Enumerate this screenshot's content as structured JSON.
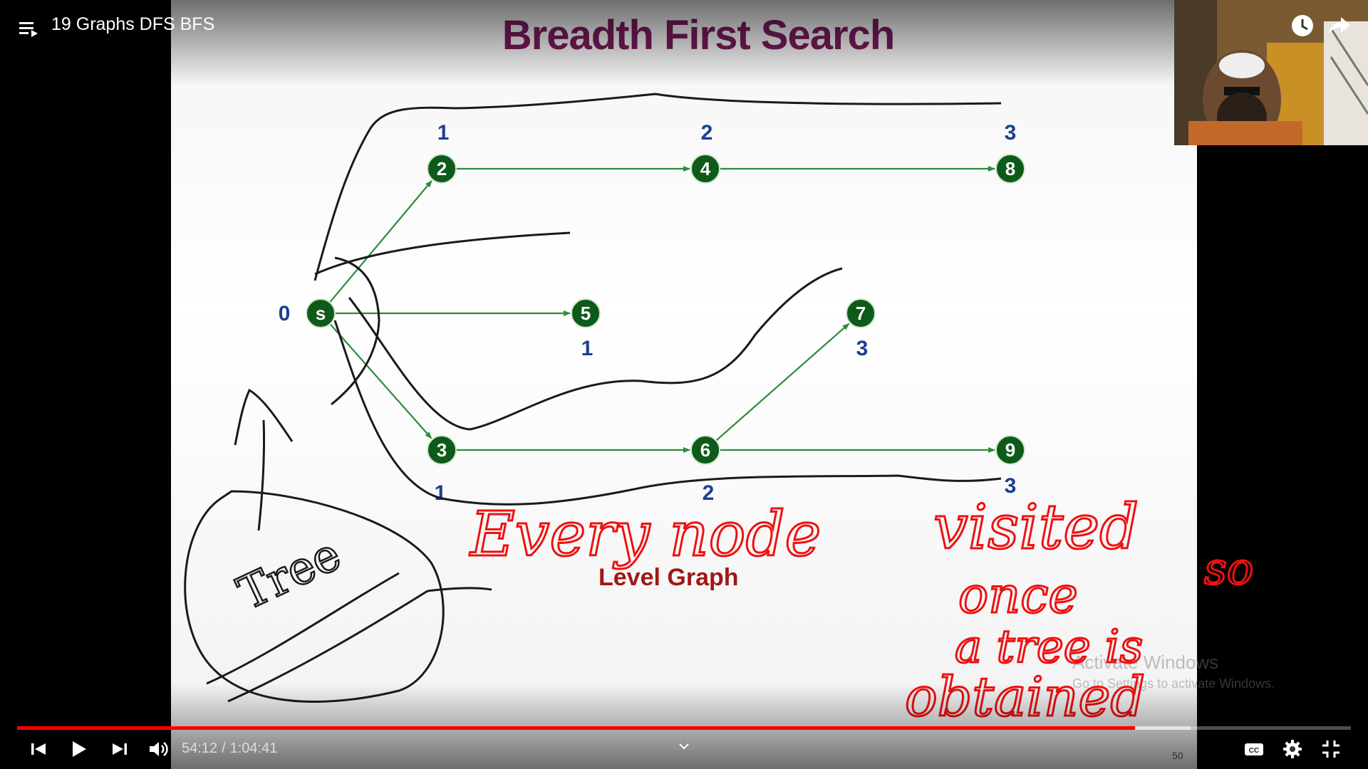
{
  "player": {
    "video_title": "19 Graphs DFS BFS",
    "time_current": "54:12",
    "time_separator": "/",
    "time_total": "1:04:41",
    "progress_played": 0.838,
    "progress_buffered": 0.88,
    "accent_color": "#ff0000",
    "icons": [
      "playlist-icon",
      "watch-later-icon",
      "share-icon",
      "previous-icon",
      "play-icon",
      "next-icon",
      "volume-icon",
      "chevron-down-icon",
      "captions-icon",
      "settings-icon",
      "exit-fullscreen-icon"
    ]
  },
  "slide": {
    "title": "Breadth First Search",
    "footer": "Level Graph",
    "page_number": "50",
    "title_color": "#7b1a5e",
    "footer_color": "#a01818",
    "node_color": "#0e5a1a",
    "edge_color": "#2e8b3a",
    "level_color": "#1c3f94",
    "nodes": [
      {
        "id": "s",
        "level": "0"
      },
      {
        "id": "2",
        "level": "1"
      },
      {
        "id": "4",
        "level": "2"
      },
      {
        "id": "8",
        "level": "3"
      },
      {
        "id": "5",
        "level": "1"
      },
      {
        "id": "7",
        "level": "3"
      },
      {
        "id": "3",
        "level": "1"
      },
      {
        "id": "6",
        "level": "2"
      },
      {
        "id": "9",
        "level": "3"
      }
    ],
    "edges": [
      [
        "s",
        "2"
      ],
      [
        "s",
        "5"
      ],
      [
        "s",
        "3"
      ],
      [
        "2",
        "4"
      ],
      [
        "4",
        "8"
      ],
      [
        "3",
        "6"
      ],
      [
        "6",
        "7"
      ],
      [
        "6",
        "9"
      ]
    ]
  },
  "watermark": {
    "line1": "Activate Windows",
    "line2": "Go to Settings to activate Windows."
  },
  "annotations": {
    "ink_color": "#ee1111",
    "handwriting_red": "Every node visited once so a tree is obtained",
    "handwriting_black": "Tree"
  }
}
